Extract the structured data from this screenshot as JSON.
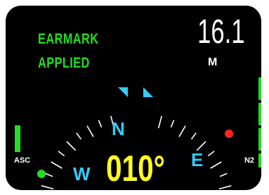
{
  "status": {
    "line1": "EARMARK",
    "line2": "APPLIED",
    "color": "#22dd22"
  },
  "depth": {
    "value": "16.1",
    "unit": "M"
  },
  "compass": {
    "heading": "010°",
    "heading_color": "#ffff22",
    "cardinal_color": "#33ccff",
    "labels": {
      "north": "N",
      "west": "W",
      "east": "E"
    },
    "markers": [
      {
        "name": "bearing-marker-east",
        "color": "#ff2222"
      },
      {
        "name": "bearing-marker-west",
        "color": "#22dd22"
      }
    ]
  },
  "gauges": {
    "asc": {
      "label": "ASC",
      "segments_lit": 1,
      "segments_total": 1
    },
    "n2": {
      "label": "N2",
      "segments_lit": 4,
      "segments_total": 4
    }
  }
}
